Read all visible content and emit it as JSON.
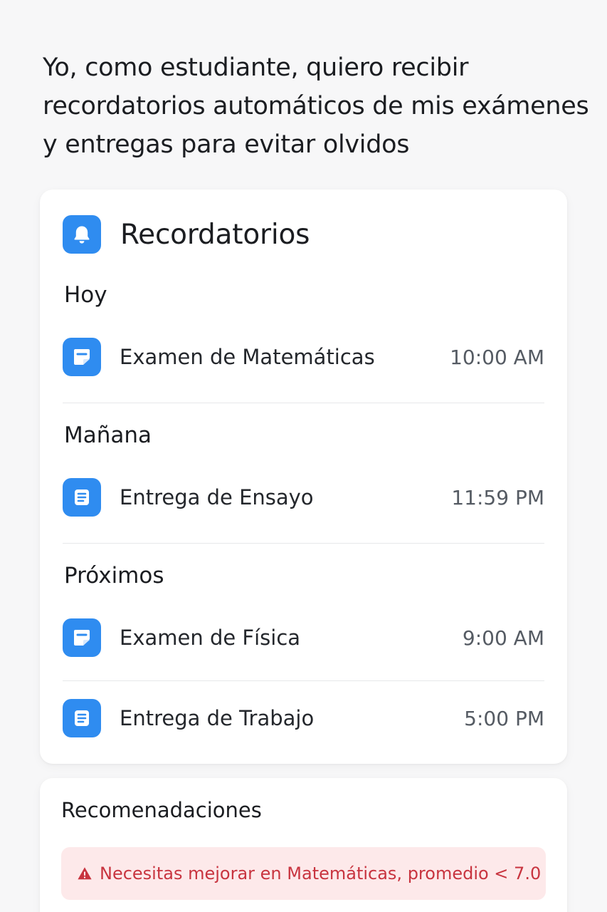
{
  "user_story": "Yo, como estudiante, quiero recibir recordatorios automáticos de mis exámenes y entregas para evitar olvidos",
  "reminders": {
    "title": "Recordatorios",
    "header_icon": "bell-icon",
    "sections": [
      {
        "label": "Hoy",
        "items": [
          {
            "name": "Examen de Matemáticas",
            "time": "10:00 AM",
            "icon": "exam-note-icon"
          }
        ]
      },
      {
        "label": "Mañana",
        "items": [
          {
            "name": "Entrega de Ensayo",
            "time": "11:59 PM",
            "icon": "assignment-document-icon"
          }
        ]
      },
      {
        "label": "Próximos",
        "items": [
          {
            "name": "Examen de Física",
            "time": "9:00 AM",
            "icon": "exam-note-icon"
          },
          {
            "name": "Entrega de Trabajo",
            "time": "5:00 PM",
            "icon": "assignment-document-icon"
          }
        ]
      }
    ]
  },
  "recommendations": {
    "title": "Recomenadaciones",
    "alert": {
      "icon": "warning-icon",
      "text": "Necesitas mejorar en Matemáticas, promedio < 7.0"
    }
  },
  "colors": {
    "accent": "#2f8cf0",
    "alert_background": "#fde9ea",
    "alert_text": "#c8343f"
  }
}
